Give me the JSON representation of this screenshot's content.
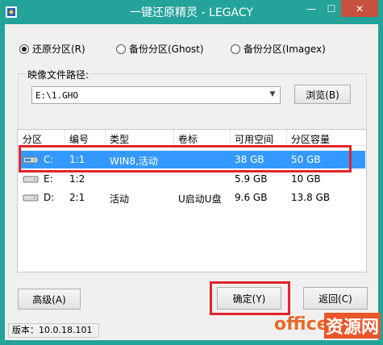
{
  "window": {
    "title": "一键还原精灵 - LEGACY",
    "controls": {
      "minimize": "—",
      "maximize": "☐",
      "close": "✕"
    },
    "colors": {
      "titlebar": "#24a39a",
      "close": "#c7503f",
      "selection": "#3399ff",
      "highlight": "#e0242b"
    }
  },
  "modes": [
    {
      "label": "还原分区(R)",
      "selected": true
    },
    {
      "label": "备份分区(Ghost)",
      "selected": false
    },
    {
      "label": "备份分区(Imagex)",
      "selected": false
    }
  ],
  "image_path": {
    "group_label": "映像文件路径:",
    "value": "E:\\1.GHO",
    "browse_label": "浏览(B)"
  },
  "table": {
    "columns": [
      "分区",
      "编号",
      "类型",
      "卷标",
      "可用空间",
      "分区容量"
    ],
    "rows": [
      {
        "drive": "C:",
        "num": "1:1",
        "type": "WIN8,活动",
        "label": "",
        "free": "38 GB",
        "size": "50 GB",
        "selected": true
      },
      {
        "drive": "E:",
        "num": "1:2",
        "type": "",
        "label": "",
        "free": "5.9 GB",
        "size": "10 GB",
        "selected": false
      },
      {
        "drive": "D:",
        "num": "2:1",
        "type": "活动",
        "label": "U启动U盘",
        "free": "9.6 GB",
        "size": "13.8 GB",
        "selected": false
      }
    ]
  },
  "buttons": {
    "advanced": "高级(A)",
    "ok": "确定(Y)",
    "back": "返回(C)"
  },
  "status": {
    "version": "版本：10.0.18.101"
  },
  "watermark": {
    "brand": "office",
    "site": "资源网"
  }
}
